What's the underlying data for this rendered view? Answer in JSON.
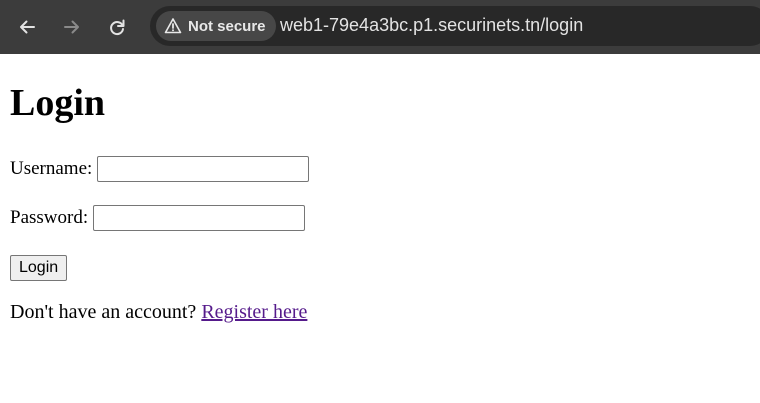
{
  "browser": {
    "security_label": "Not secure",
    "url": "web1-79e4a3bc.p1.securinets.tn/login",
    "icons": {
      "back": "arrow-left-icon",
      "forward": "arrow-right-icon",
      "reload": "reload-icon",
      "security": "warning-triangle-icon"
    }
  },
  "page": {
    "title": "Login",
    "username_label": "Username:",
    "username_value": "",
    "password_label": "Password:",
    "password_value": "",
    "submit_label": "Login",
    "register_prompt": "Don't have an account?",
    "register_link": "Register here"
  },
  "colors": {
    "toolbar_bg": "#3c3c3c",
    "omnibox_bg": "#282828",
    "link_visited": "#551a8b"
  }
}
